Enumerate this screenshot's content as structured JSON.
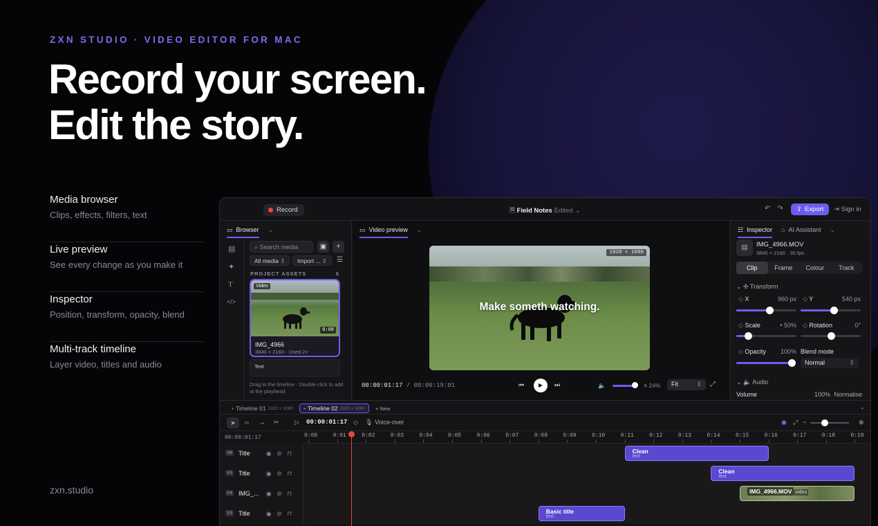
{
  "hero": {
    "eyebrow": "ZXN STUDIO  ·  VIDEO EDITOR FOR MAC",
    "headline_line1": "Record your screen.",
    "headline_line2": "Edit the story.",
    "features": [
      {
        "title": "Media browser",
        "desc": "Clips, effects, filters, text"
      },
      {
        "title": "Live preview",
        "desc": "See every change as you make it"
      },
      {
        "title": "Inspector",
        "desc": "Position, transform, opacity, blend"
      },
      {
        "title": "Multi-track timeline",
        "desc": "Layer video, titles and audio"
      }
    ],
    "domain": "zxn.studio"
  },
  "titlebar": {
    "record_label": "Record",
    "document_name": "Field Notes",
    "document_status": "Edited",
    "export_label": "Export",
    "signin_label": "Sign in"
  },
  "browser": {
    "tab_label": "Browser",
    "search_placeholder": "Search media",
    "filter_value": "All media",
    "import_value": "Import ...",
    "section_title": "PROJECT ASSETS",
    "section_count": "6",
    "card": {
      "badge": "Video",
      "duration": "0:08",
      "name": "IMG_4966",
      "meta": "3840 × 2160 · Used 2×"
    },
    "text_card_label": "Text",
    "hint": "Drag to the timeline · Double-click to add at the playhead"
  },
  "preview": {
    "tab_label": "Video preview",
    "resolution": "1920 × 1080",
    "caption": "Make someth         watching.",
    "timecode_current": "00:00:01:17",
    "timecode_total": "/ 00:00:19:01",
    "volume_level": 0.8,
    "zoom": "24%",
    "fit_value": "Fit"
  },
  "inspector": {
    "tab_label": "Inspector",
    "ai_tab_label": "AI Assistant",
    "file_name": "IMG_4966.MOV",
    "file_meta": "3840 × 2160 · 30 fps",
    "segments": [
      "Clip",
      "Frame",
      "Colour",
      "Track"
    ],
    "active_segment": "Clip",
    "transform_label": "Transform",
    "x_label": "X",
    "x_value": "960 px",
    "x_level": 0.55,
    "y_label": "Y",
    "y_value": "540 px",
    "y_level": 0.55,
    "scale_label": "Scale",
    "scale_value": "• 50%",
    "scale_level": 0.2,
    "rotation_label": "Rotation",
    "rotation_value": "0°",
    "rotation_level": 0.5,
    "opacity_label": "Opacity",
    "opacity_value": "100%",
    "opacity_level": 1.0,
    "blend_label": "Blend mode",
    "blend_value": "Normal",
    "audio_label": "Audio",
    "volume_label": "Volume",
    "volume_value": "100%",
    "normalise_label": "Normalise"
  },
  "timeline": {
    "tabs": [
      {
        "label": "Timeline 01",
        "res": "1920 × 1080",
        "active": false
      },
      {
        "label": "Timeline 02",
        "res": "1920 × 1080",
        "active": true
      }
    ],
    "new_label": "+ New",
    "timecode": "00:00:01:17",
    "voiceover_label": "Voice-over",
    "ruler_timecode": "00:00:01:17",
    "ticks": [
      "0:00",
      "0:01",
      "0:02",
      "0:03",
      "0:04",
      "0:05",
      "0:06",
      "0:07",
      "0:08",
      "0:09",
      "0:10",
      "0:11",
      "0:12",
      "0:13",
      "0:14",
      "0:15",
      "0:16",
      "0:17",
      "0:18",
      "0:19"
    ],
    "tracks": [
      {
        "tag": "V6",
        "name": "Title"
      },
      {
        "tag": "V5",
        "name": "Title"
      },
      {
        "tag": "V4",
        "name": "IMG_..."
      },
      {
        "tag": "V3",
        "name": "Title"
      }
    ],
    "clips": [
      {
        "title": "Clean",
        "kind": "text",
        "track": 0,
        "start": 11.0,
        "end": 16.0
      },
      {
        "title": "Clean",
        "kind": "text",
        "track": 1,
        "start": 14.0,
        "end": 19.0
      },
      {
        "title": "IMG_4966.MOV",
        "kind": "video",
        "track": 2,
        "start": 15.0,
        "end": 19.0
      },
      {
        "title": "Basic title",
        "kind": "text",
        "track": 3,
        "start": 8.0,
        "end": 11.0
      }
    ],
    "playhead_time": 1.5
  },
  "colors": {
    "accent": "#6d5cf0",
    "record": "#e64545",
    "clip": "#5a48d0"
  }
}
